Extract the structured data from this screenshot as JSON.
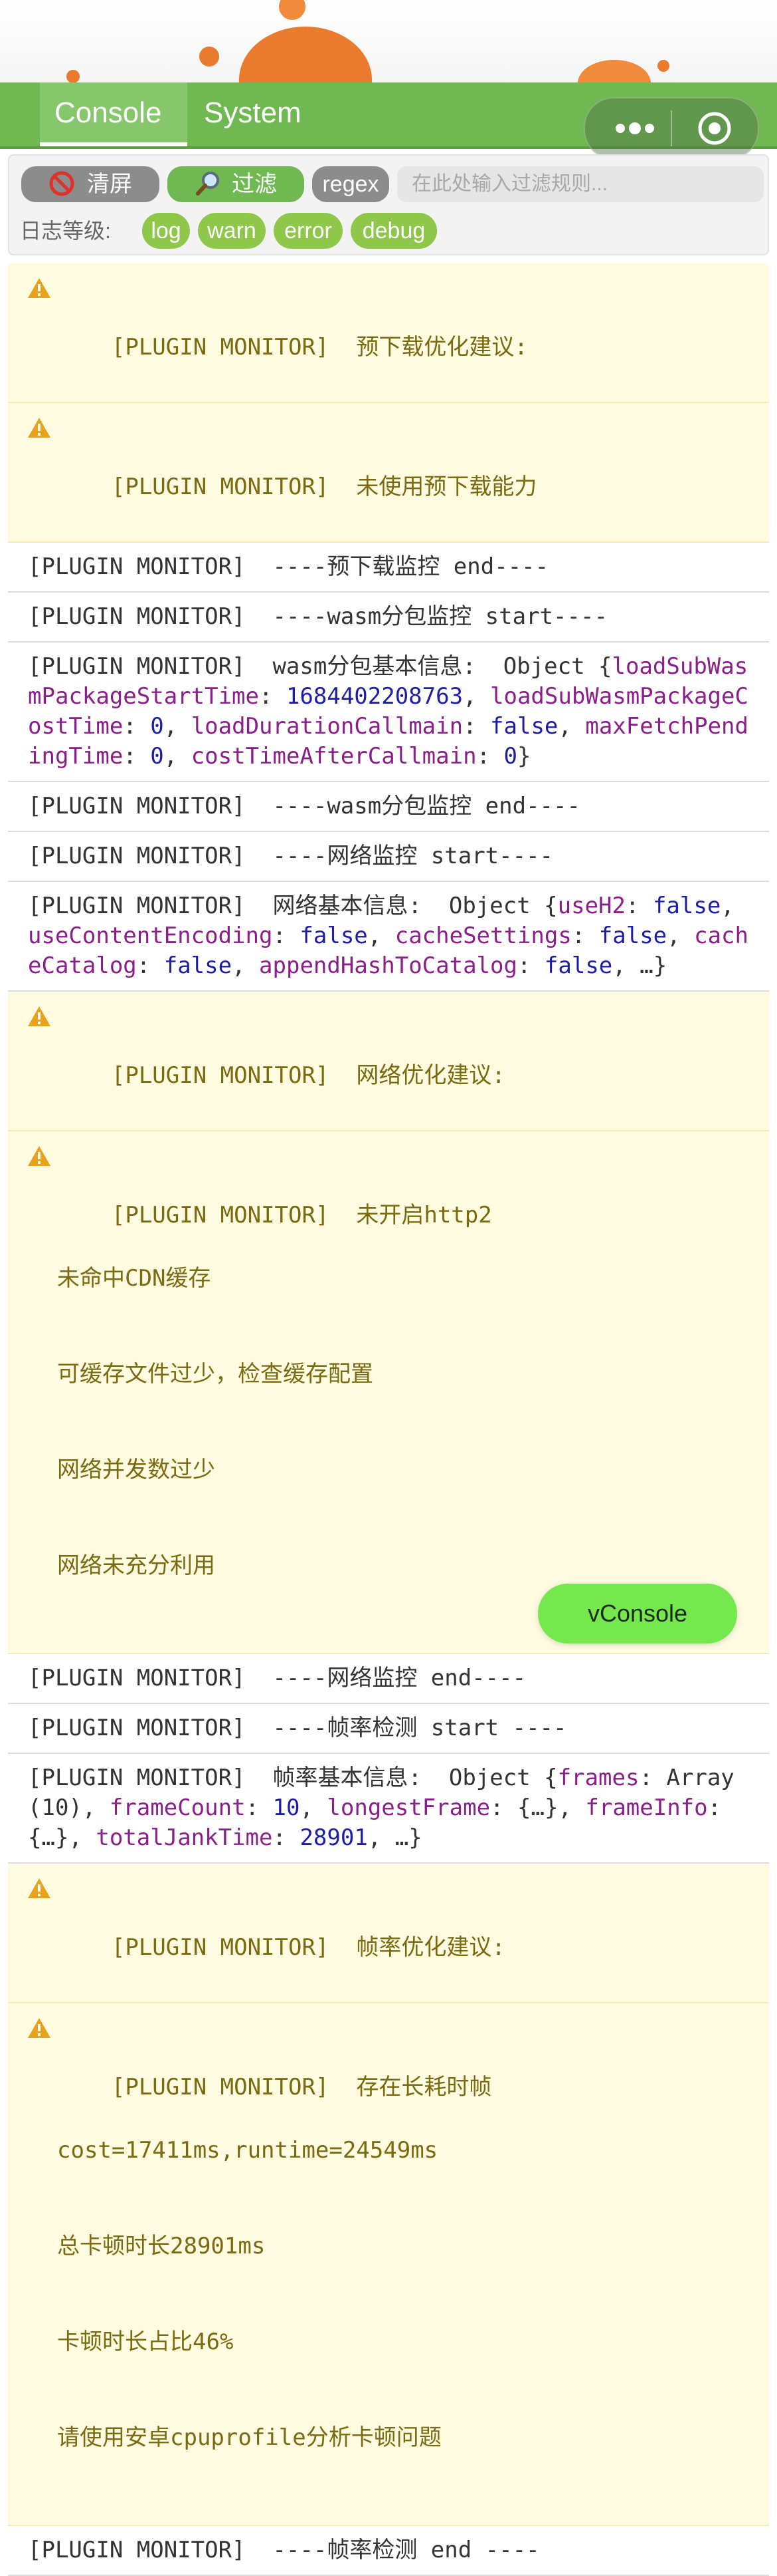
{
  "tabs": [
    {
      "label": "Console",
      "active": true
    },
    {
      "label": "System",
      "active": false
    }
  ],
  "toolbar": {
    "clear_label": "清屏",
    "filter_label": "过滤",
    "regex_label": "regex",
    "filter_placeholder": "在此处输入过滤规则...",
    "level_label": "日志等级:",
    "levels": [
      "log",
      "warn",
      "error",
      "debug"
    ]
  },
  "logs": [
    {
      "type": "warn",
      "lines": [
        "[PLUGIN MONITOR]  预下载优化建议:"
      ]
    },
    {
      "type": "warn",
      "lines": [
        "[PLUGIN MONITOR]  未使用预下载能力"
      ]
    },
    {
      "type": "log",
      "lines": [
        "[PLUGIN MONITOR]  ----预下载监控 end----"
      ]
    },
    {
      "type": "log",
      "lines": [
        "[PLUGIN MONITOR]  ----wasm分包监控 start----"
      ]
    },
    {
      "type": "log",
      "obj_prefix": "[PLUGIN MONITOR]  wasm分包基本信息:  Object {",
      "obj_pairs": [
        {
          "k": "loadSubWasmPackageStartTime",
          "v": "1684402208763"
        },
        {
          "k": "loadSubWasmPackageCostTime",
          "v": "0"
        },
        {
          "k": "loadDurationCallmain",
          "v": "false"
        },
        {
          "k": "maxFetchPendingTime",
          "v": "0"
        },
        {
          "k": "costTimeAfterCallmain",
          "v": "0"
        }
      ],
      "obj_suffix": "}"
    },
    {
      "type": "log",
      "lines": [
        "[PLUGIN MONITOR]  ----wasm分包监控 end----"
      ]
    },
    {
      "type": "log",
      "lines": [
        "[PLUGIN MONITOR]  ----网络监控 start----"
      ]
    },
    {
      "type": "log",
      "obj_prefix": "[PLUGIN MONITOR]  网络基本信息:  Object {",
      "obj_pairs": [
        {
          "k": "useH2",
          "v": "false"
        },
        {
          "k": "useContentEncoding",
          "v": "false"
        },
        {
          "k": "cacheSettings",
          "v": "false"
        },
        {
          "k": "cacheCatalog",
          "v": "false"
        },
        {
          "k": "appendHashToCatalog",
          "v": "false"
        }
      ],
      "obj_suffix": ", …}"
    },
    {
      "type": "warn",
      "lines": [
        "[PLUGIN MONITOR]  网络优化建议:"
      ]
    },
    {
      "type": "warn",
      "lines": [
        "[PLUGIN MONITOR]  未开启http2",
        "未命中CDN缓存",
        "可缓存文件过少，检查缓存配置",
        "网络并发数过少",
        "网络未充分利用"
      ]
    },
    {
      "type": "log",
      "lines": [
        "[PLUGIN MONITOR]  ----网络监控 end----"
      ]
    },
    {
      "type": "log",
      "lines": [
        "[PLUGIN MONITOR]  ----帧率检测 start ----"
      ]
    },
    {
      "type": "log",
      "obj_prefix": "[PLUGIN MONITOR]  帧率基本信息:  Object {",
      "obj_pairs": [
        {
          "k": "frames",
          "v": "Array(10)",
          "plain": true
        },
        {
          "k": "frameCount",
          "v": "10"
        },
        {
          "k": "longestFrame",
          "v": "{…}",
          "plain": true
        },
        {
          "k": "frameInfo",
          "v": "{…}",
          "plain": true
        },
        {
          "k": "totalJankTime",
          "v": "28901"
        }
      ],
      "obj_suffix": ", …}"
    },
    {
      "type": "warn",
      "lines": [
        "[PLUGIN MONITOR]  帧率优化建议:"
      ]
    },
    {
      "type": "warn",
      "lines": [
        "[PLUGIN MONITOR]  存在长耗时帧",
        "cost=17411ms,runtime=24549ms",
        "总卡顿时长28901ms",
        "卡顿时长占比46%",
        "请使用安卓cpuprofile分析卡顿问题"
      ]
    },
    {
      "type": "log",
      "lines": [
        "[PLUGIN MONITOR]  ----帧率检测 end ----"
      ]
    }
  ],
  "vconsole_label": "vConsole",
  "colors": {
    "tab_bar": "#6fb852",
    "warn_bg": "#fffbe0",
    "vconsole_button": "#74e84d",
    "chip": "#8fc74a"
  }
}
